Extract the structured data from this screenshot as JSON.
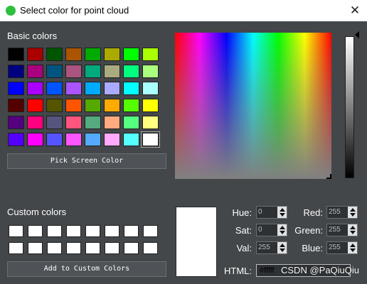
{
  "window": {
    "title": "Select color for point cloud"
  },
  "basic_colors": {
    "label": "Basic colors",
    "swatches": [
      "#000000",
      "#aa0000",
      "#005500",
      "#aa5500",
      "#00aa00",
      "#aaaa00",
      "#00ff00",
      "#aaff00",
      "#00007f",
      "#aa007f",
      "#00557f",
      "#aa557f",
      "#00aa7f",
      "#aaaa7f",
      "#00ff7f",
      "#aaff7f",
      "#0000ff",
      "#aa00ff",
      "#0055ff",
      "#aa55ff",
      "#00aaff",
      "#aaaaff",
      "#00ffff",
      "#aaffff",
      "#550000",
      "#ff0000",
      "#555500",
      "#ff5500",
      "#55aa00",
      "#ffaa00",
      "#55ff00",
      "#ffff00",
      "#55007f",
      "#ff007f",
      "#55557f",
      "#ff557f",
      "#55aa7f",
      "#ffaa7f",
      "#55ff7f",
      "#ffff7f",
      "#5500ff",
      "#ff00ff",
      "#5555ff",
      "#ff55ff",
      "#55aaff",
      "#ffaaff",
      "#55ffff",
      "#ffffff"
    ],
    "selected_index": 47
  },
  "pick_screen_button": "Pick Screen Color",
  "custom_colors": {
    "label": "Custom colors",
    "swatches": [
      "#ffffff",
      "#ffffff",
      "#ffffff",
      "#ffffff",
      "#ffffff",
      "#ffffff",
      "#ffffff",
      "#ffffff",
      "#ffffff",
      "#ffffff",
      "#ffffff",
      "#ffffff",
      "#ffffff",
      "#ffffff",
      "#ffffff",
      "#ffffff"
    ]
  },
  "add_custom_button": "Add to Custom Colors",
  "current_color": "#ffffff",
  "fields": {
    "hue": {
      "label": "Hue:",
      "value": "0"
    },
    "sat": {
      "label": "Sat:",
      "value": "0"
    },
    "val": {
      "label": "Val:",
      "value": "255"
    },
    "red": {
      "label": "Red:",
      "value": "255"
    },
    "green": {
      "label": "Green:",
      "value": "255"
    },
    "blue": {
      "label": "Blue:",
      "value": "255"
    }
  },
  "html": {
    "label": "HTML:",
    "value": "#fffff"
  },
  "watermark": "CSDN @PaQiuQiu"
}
